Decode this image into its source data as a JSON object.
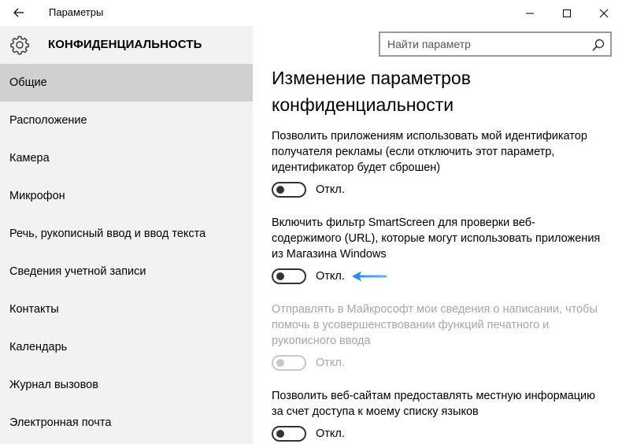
{
  "window": {
    "title": "Параметры",
    "controls": {
      "minimize": "minimize",
      "maximize": "maximize",
      "close": "close"
    }
  },
  "header": {
    "title": "КОНФИДЕНЦИАЛЬНОСТЬ"
  },
  "search": {
    "placeholder": "Найти параметр"
  },
  "sidebar": {
    "items": [
      {
        "label": "Общие",
        "selected": true
      },
      {
        "label": "Расположение"
      },
      {
        "label": "Камера"
      },
      {
        "label": "Микрофон"
      },
      {
        "label": "Речь, рукописный ввод и ввод текста"
      },
      {
        "label": "Сведения учетной записи"
      },
      {
        "label": "Контакты"
      },
      {
        "label": "Календарь"
      },
      {
        "label": "Журнал вызовов"
      },
      {
        "label": "Электронная почта"
      }
    ]
  },
  "main": {
    "title": "Изменение параметров конфиденциальности",
    "settings": [
      {
        "description": "Позволить приложениям использовать мой идентификатор получателя рекламы (если отключить этот параметр, идентификатор будет сброшен)",
        "state": "Откл.",
        "enabled": true
      },
      {
        "description": "Включить фильтр SmartScreen для проверки веб-содержимого (URL), которые могут использовать приложения из Магазина Windows",
        "state": "Откл.",
        "enabled": true
      },
      {
        "description": "Отправлять в Майкрософт мои сведения о написании, чтобы помочь в усовершенствовании функций печатного и рукописного ввода",
        "state": "Откл.",
        "enabled": false
      },
      {
        "description": "Позволить веб-сайтам предоставлять местную информацию за счет доступа к моему списку языков",
        "state": "Откл.",
        "enabled": true
      }
    ]
  },
  "colors": {
    "sidebar_bg": "#f2f2f2",
    "selected_bg": "#d0d0d0",
    "disabled_text": "#a6a6a6",
    "annotation_arrow": "#1e88e5"
  }
}
